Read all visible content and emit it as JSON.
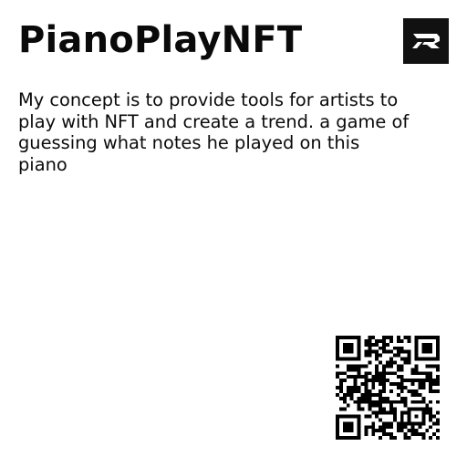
{
  "card": {
    "title": "PianoPlayNFT",
    "description": "My concept is to provide tools for artists to play with NFT and create a trend. a game of guessing what notes he played on this piano"
  },
  "icons": {
    "logo": "brand-logo-icon",
    "qr": "qr-code"
  },
  "colors": {
    "text": "#0a0a0a",
    "logo_background": "#111111",
    "logo_mark": "#ffffff",
    "background": "#ffffff"
  }
}
